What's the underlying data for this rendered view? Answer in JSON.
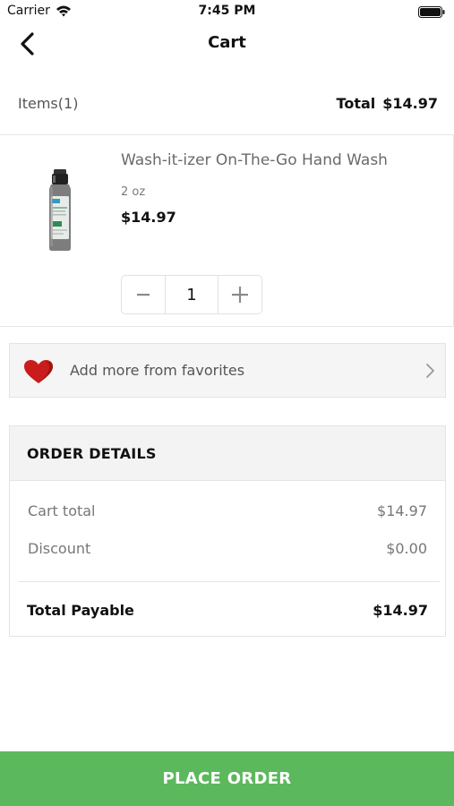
{
  "status_bar": {
    "carrier": "Carrier",
    "time": "7:45 PM"
  },
  "nav": {
    "title": "Cart",
    "back_icon": "chevron-left-icon"
  },
  "summary": {
    "items_label": "Items",
    "items_count": "(1)",
    "total_label": "Total",
    "total_value": "$14.97"
  },
  "cart_items": [
    {
      "name": "Wash-it-izer On-The-Go Hand Wash",
      "size": "2 oz",
      "price": "$14.97",
      "quantity": "1",
      "image_icon": "hand-wash-bottle-image"
    }
  ],
  "favorites": {
    "label": "Add more from favorites",
    "icon": "heart-icon"
  },
  "order_details": {
    "title": "ORDER DETAILS",
    "cart_total_label": "Cart total",
    "cart_total_value": "$14.97",
    "discount_label": "Discount",
    "discount_value": "$0.00",
    "total_payable_label": "Total Payable",
    "total_payable_value": "$14.97"
  },
  "place_order": {
    "label": "PLACE ORDER"
  },
  "colors": {
    "accent_green": "#5cb85c",
    "heart_red": "#c91c1c"
  }
}
